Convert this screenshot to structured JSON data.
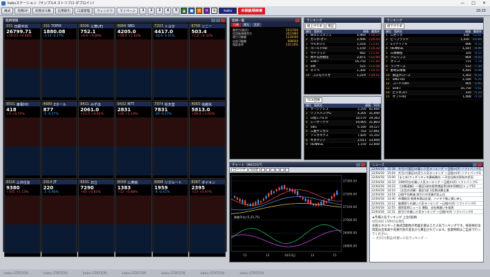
{
  "app": {
    "title": "kabuステーション（サンプル4 ストリブロ-ダブロイン）",
    "time": "18:25"
  },
  "toolbar": {
    "logo": "kabu",
    "items": [
      "株式",
      "先物OP",
      "先物ダ/1数",
      "信用取引",
      "口座管理",
      "ウィンドウ",
      "マイページ"
    ],
    "pages": [
      "1",
      "2",
      "3",
      "4",
      "5"
    ],
    "search_label": "米株銘柄検索"
  },
  "board": {
    "title": "銘柄情報",
    "tiles": [
      {
        "code": "151",
        "name": "日経平均",
        "price": "26799.71",
        "chg": "+16.03",
        "pct": "+0.06%",
        "dir": "up"
      },
      {
        "code": "151",
        "name": "TOPIX",
        "price": "1880.08",
        "chg": "-3.14",
        "pct": "-0.17%",
        "dir": "dn"
      },
      {
        "code": "8306",
        "name": "三菱UFJ",
        "price": "752.1",
        "chg": "+6.6",
        "pct": "+0.89%",
        "dir": "up"
      },
      {
        "code": "9984",
        "name": "SBG",
        "price": "4205.0",
        "chg": "+59.0",
        "pct": "+1.42%",
        "dir": "up"
      },
      {
        "code": "7203",
        "name": "トヨタ",
        "price": "4417.0",
        "chg": "-18.0",
        "pct": "-0.41%",
        "dir": "dn"
      },
      {
        "code": "6758",
        "name": "ソニー",
        "price": "503.4",
        "chg": "+1.6",
        "pct": "+0.32%",
        "dir": "up"
      },
      {
        "code": "9501",
        "name": "東電HD",
        "price": "418",
        "chg": "+3",
        "pct": "+0.72%",
        "dir": "up"
      },
      {
        "code": "4689",
        "name": "Zホール",
        "price": "877",
        "chg": "-5",
        "pct": "-0.57%",
        "dir": "dn"
      },
      {
        "code": "8411",
        "name": "みずほ",
        "price": "2061.0",
        "chg": "+12.5",
        "pct": "+0.61%",
        "dir": "up"
      },
      {
        "code": "9432",
        "name": "NTT",
        "price": "2831",
        "chg": "+32",
        "pct": "+1.14%",
        "dir": "up"
      },
      {
        "code": "7974",
        "name": "任天堂",
        "price": "7831",
        "chg": "-29",
        "pct": "-0.37%",
        "dir": "dn"
      },
      {
        "code": "4063",
        "name": "信越化",
        "price": "5813.0",
        "chg": "+59.0",
        "pct": "+1.03%",
        "dir": "up"
      },
      {
        "code": "8316",
        "name": "三井住友",
        "price": "9380",
        "chg": "+105",
        "pct": "+1.13%",
        "dir": "up"
      },
      {
        "code": "2914",
        "name": "JT",
        "price": "220",
        "chg": "-2",
        "pct": "-0.90%",
        "dir": "dn"
      },
      {
        "code": "6501",
        "name": "日立",
        "price": "7290",
        "chg": "+60",
        "pct": "+0.83%",
        "dir": "up"
      },
      {
        "code": "8058",
        "name": "三菱商",
        "price": "1383",
        "chg": "+12",
        "pct": "+0.88%",
        "dir": "up"
      },
      {
        "code": "6098",
        "name": "リクルート",
        "price": "1959",
        "chg": "-8",
        "pct": "-0.41%",
        "dir": "dn"
      },
      {
        "code": "6367",
        "name": "ダイキン",
        "price": "2395",
        "chg": "+23",
        "pct": "+0.97%",
        "dir": "up"
      }
    ]
  },
  "summary": {
    "title": "銘柄一覧",
    "rows": [
      {
        "k": "買余力(株式)",
        "v": "5012500"
      },
      {
        "k": "信用新規建余力",
        "v": "3012980"
      },
      {
        "k": "現引可能額",
        "v": "1234500"
      },
      {
        "k": "出金可能額",
        "v": "998000"
      },
      {
        "k": "保証金率",
        "v": "135.20%"
      }
    ]
  },
  "ranking_a": {
    "title": "ランキング",
    "select1": "値上がり率",
    "select2": "東証",
    "rows": [
      {
        "rank": "1",
        "name": "Wエジスタンス",
        "price": "4,960",
        "pct": "+18.23"
      },
      {
        "rank": "2",
        "name": "ガンホ-オン",
        "price": "2,406",
        "pct": "+16.93"
      },
      {
        "rank": "3",
        "name": "ウルボジャ",
        "price": "1,018",
        "pct": "+15.61"
      },
      {
        "rank": "4",
        "name": "ゴールドHD",
        "price": "1,150",
        "pct": "+14.32"
      },
      {
        "rank": "5",
        "name": "ウイラッジ",
        "price": "682",
        "pct": "+13.41"
      },
      {
        "rank": "6",
        "name": "神戸天然物化",
        "price": "2,871",
        "pct": "+12.90"
      },
      {
        "rank": "7",
        "name": "SHIFT",
        "price": "16,750",
        "pct": "+11.82"
      },
      {
        "rank": "8",
        "name": "SW",
        "price": "521",
        "pct": "+11.08"
      },
      {
        "rank": "9",
        "name": "エイベ",
        "price": "1,304",
        "pct": "+10.55"
      },
      {
        "rank": "10",
        "name": "コスモバイオ",
        "price": "1,219",
        "pct": "+10.11"
      }
    ]
  },
  "ranking_b": {
    "title": "ランキング",
    "select1": "TICK回数",
    "rows": [
      {
        "rank": "1",
        "name": "サーシアレス",
        "price": "2,250",
        "pct": "42,666"
      },
      {
        "rank": "2",
        "name": "ソフトバンクG",
        "price": "4,205",
        "pct": "31,440"
      },
      {
        "rank": "3",
        "name": "日経レバETF",
        "price": "18,570",
        "pct": "29,383"
      },
      {
        "rank": "4",
        "name": "レーザーテク",
        "price": "19,905",
        "pct": "21,803"
      },
      {
        "rank": "5",
        "name": "SBG",
        "price": "6,180",
        "pct": "19,527"
      },
      {
        "rank": "6",
        "name": "三菱ケミカル",
        "price": "752",
        "pct": "17,661"
      },
      {
        "rank": "7",
        "name": "ソシオネクス",
        "price": "7,820",
        "pct": "15,102"
      },
      {
        "rank": "8",
        "name": "キオクシア",
        "price": "2,011",
        "pct": "13,944"
      },
      {
        "rank": "9",
        "name": "HENNGE",
        "price": "1,150",
        "pct": "12,608"
      }
    ]
  },
  "ranking_c": {
    "title": "ランキング",
    "select1": "値下がり率",
    "rows": [
      {
        "rank": "1",
        "name": "ロゼッタ",
        "price": "428",
        "pct": "-12.01"
      },
      {
        "rank": "2",
        "name": "ビープラッツ",
        "price": "1,550",
        "pct": "-10.84"
      },
      {
        "rank": "3",
        "name": "Sマテリアル",
        "price": "896",
        "pct": "-9.52"
      },
      {
        "rank": "4",
        "name": "HENNGE",
        "price": "1,187",
        "pct": "-8.90"
      },
      {
        "rank": "5",
        "name": "日本精密",
        "price": "320",
        "pct": "-8.55"
      },
      {
        "rank": "6",
        "name": "クロップス",
        "price": "804",
        "pct": "-8.03"
      },
      {
        "rank": "7",
        "name": "オンコ",
        "price": "715",
        "pct": "-7.74"
      },
      {
        "rank": "8",
        "name": "ランサーズ",
        "price": "512",
        "pct": "-7.30"
      },
      {
        "rank": "9",
        "name": "野村日本株",
        "price": "4,445",
        "pct": "-6.98"
      },
      {
        "rank": "10",
        "name": "東証グロース",
        "price": "1,302",
        "pct": "-6.51"
      },
      {
        "rank": "11",
        "name": "SMD HD",
        "price": "2,180",
        "pct": "-6.20"
      },
      {
        "rank": "12",
        "name": "コードTORT",
        "price": "905",
        "pct": "-5.95"
      },
      {
        "rank": "13",
        "name": "SHIFT",
        "price": "16,750",
        "pct": "-5.61"
      },
      {
        "rank": "14",
        "name": "ビジネスIT",
        "price": "310",
        "pct": "-5.33"
      },
      {
        "rank": "15",
        "name": "オプトHD",
        "price": "1,488",
        "pct": "-5.10"
      }
    ]
  },
  "chart": {
    "title": "チャート（NK225/T）",
    "symbol": "ローソク",
    "period": "5分足",
    "indicator": "移動平均 (5,25,75)",
    "x_ticks": [
      "15",
      "13",
      "10/13日",
      "13",
      "15"
    ],
    "y_ticks": [
      "27300.00",
      "27200.00",
      "27100.00",
      "27000.00",
      "26900.00",
      "26800.00"
    ]
  },
  "news": {
    "title": "ニュース",
    "rows": [
      {
        "date": "22/04/18",
        "time": "15:38",
        "text": "大引け(東証)の買い人気ランキング ～日経ｍ(X) ソフトバンクG"
      },
      {
        "date": "22/04/18",
        "time": "15:04",
        "text": "大引け(東証)の売り人気ランキング ～日経ｍ(X) ソフトバンクG"
      },
      {
        "date": "22/04/18",
        "time": "15:00",
        "text": "(まとめ)フィデリティの最新動向 ～子会社株式保有の状況"
      },
      {
        "date": "22/04/18",
        "time": "14:33",
        "text": "14時45分の買い人気ランキング ～日経ｍ(X) ソフトバンクG"
      },
      {
        "date": "22/04/18",
        "time": "14:22",
        "text": "《決算速報》～東証1部の経常増益率(前年同期比)トップ10"
      },
      {
        "date": "22/04/18",
        "time": "14:10",
        "text": "（注目の決算）東証1部 3月期決算企業"
      },
      {
        "date": "22/04/18",
        "time": "13:54",
        "text": "日経平均株価 前引けの売買代金上位"
      },
      {
        "date": "22/04/18",
        "time": "13:40",
        "text": "市場概況 新興市場は反発、ハイテク株に買い戻し"
      },
      {
        "date": "22/04/18",
        "time": "13:12",
        "text": "後場寄りの買い人気ランキング ～日経ｍ(X) ソフトバンクG"
      },
      {
        "date": "22/04/18",
        "time": "12:55",
        "text": "個別銘柄ニュース 増配、自社株買いを発表"
      },
      {
        "date": "22/04/18",
        "time": "12:31",
        "text": "前引けの買い人気ランキング ～日経ｍ(X) ソフトバンクG"
      }
    ],
    "body_title": "★市場人気ランキング 上位5銘柄",
    "body_date": "4月18日 15時05分現在",
    "body": "売買エネルギーと株式流動性の両面を踏まえた人気ランキングです。各銘柄の注目度は出来高や売買代金の変化から算出されています。投資判断はご自身で行ってください。",
    "footer": "― 大引け(東証)の買い人気ランキング ―"
  },
  "colors": {
    "up": "#ff5a5a",
    "down": "#4aa3ff",
    "panel_bg": "#050505",
    "title_bg": "#1a2138",
    "accent": "#d6161d"
  },
  "taskbar": {
    "items": [
      "kabu.STATION",
      "kabu.STATION",
      "kabu.STATION",
      "kabu.STATION",
      "kabu.STATION",
      "kabu.STATION",
      "kabu.STATION"
    ]
  }
}
